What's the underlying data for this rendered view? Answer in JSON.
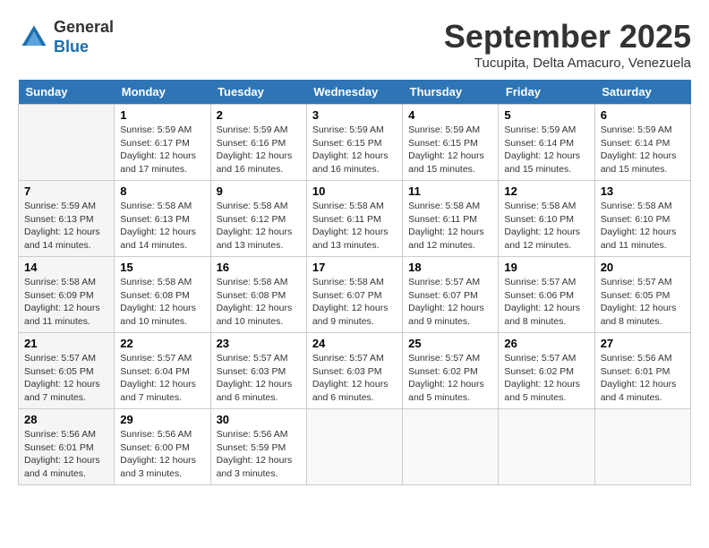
{
  "header": {
    "logo_line1": "General",
    "logo_line2": "Blue",
    "month": "September 2025",
    "location": "Tucupita, Delta Amacuro, Venezuela"
  },
  "weekdays": [
    "Sunday",
    "Monday",
    "Tuesday",
    "Wednesday",
    "Thursday",
    "Friday",
    "Saturday"
  ],
  "weeks": [
    [
      {
        "day": "",
        "info": ""
      },
      {
        "day": "1",
        "info": "Sunrise: 5:59 AM\nSunset: 6:17 PM\nDaylight: 12 hours\nand 17 minutes."
      },
      {
        "day": "2",
        "info": "Sunrise: 5:59 AM\nSunset: 6:16 PM\nDaylight: 12 hours\nand 16 minutes."
      },
      {
        "day": "3",
        "info": "Sunrise: 5:59 AM\nSunset: 6:15 PM\nDaylight: 12 hours\nand 16 minutes."
      },
      {
        "day": "4",
        "info": "Sunrise: 5:59 AM\nSunset: 6:15 PM\nDaylight: 12 hours\nand 15 minutes."
      },
      {
        "day": "5",
        "info": "Sunrise: 5:59 AM\nSunset: 6:14 PM\nDaylight: 12 hours\nand 15 minutes."
      },
      {
        "day": "6",
        "info": "Sunrise: 5:59 AM\nSunset: 6:14 PM\nDaylight: 12 hours\nand 15 minutes."
      }
    ],
    [
      {
        "day": "7",
        "info": "Sunrise: 5:59 AM\nSunset: 6:13 PM\nDaylight: 12 hours\nand 14 minutes."
      },
      {
        "day": "8",
        "info": "Sunrise: 5:58 AM\nSunset: 6:13 PM\nDaylight: 12 hours\nand 14 minutes."
      },
      {
        "day": "9",
        "info": "Sunrise: 5:58 AM\nSunset: 6:12 PM\nDaylight: 12 hours\nand 13 minutes."
      },
      {
        "day": "10",
        "info": "Sunrise: 5:58 AM\nSunset: 6:11 PM\nDaylight: 12 hours\nand 13 minutes."
      },
      {
        "day": "11",
        "info": "Sunrise: 5:58 AM\nSunset: 6:11 PM\nDaylight: 12 hours\nand 12 minutes."
      },
      {
        "day": "12",
        "info": "Sunrise: 5:58 AM\nSunset: 6:10 PM\nDaylight: 12 hours\nand 12 minutes."
      },
      {
        "day": "13",
        "info": "Sunrise: 5:58 AM\nSunset: 6:10 PM\nDaylight: 12 hours\nand 11 minutes."
      }
    ],
    [
      {
        "day": "14",
        "info": "Sunrise: 5:58 AM\nSunset: 6:09 PM\nDaylight: 12 hours\nand 11 minutes."
      },
      {
        "day": "15",
        "info": "Sunrise: 5:58 AM\nSunset: 6:08 PM\nDaylight: 12 hours\nand 10 minutes."
      },
      {
        "day": "16",
        "info": "Sunrise: 5:58 AM\nSunset: 6:08 PM\nDaylight: 12 hours\nand 10 minutes."
      },
      {
        "day": "17",
        "info": "Sunrise: 5:58 AM\nSunset: 6:07 PM\nDaylight: 12 hours\nand 9 minutes."
      },
      {
        "day": "18",
        "info": "Sunrise: 5:57 AM\nSunset: 6:07 PM\nDaylight: 12 hours\nand 9 minutes."
      },
      {
        "day": "19",
        "info": "Sunrise: 5:57 AM\nSunset: 6:06 PM\nDaylight: 12 hours\nand 8 minutes."
      },
      {
        "day": "20",
        "info": "Sunrise: 5:57 AM\nSunset: 6:05 PM\nDaylight: 12 hours\nand 8 minutes."
      }
    ],
    [
      {
        "day": "21",
        "info": "Sunrise: 5:57 AM\nSunset: 6:05 PM\nDaylight: 12 hours\nand 7 minutes."
      },
      {
        "day": "22",
        "info": "Sunrise: 5:57 AM\nSunset: 6:04 PM\nDaylight: 12 hours\nand 7 minutes."
      },
      {
        "day": "23",
        "info": "Sunrise: 5:57 AM\nSunset: 6:03 PM\nDaylight: 12 hours\nand 6 minutes."
      },
      {
        "day": "24",
        "info": "Sunrise: 5:57 AM\nSunset: 6:03 PM\nDaylight: 12 hours\nand 6 minutes."
      },
      {
        "day": "25",
        "info": "Sunrise: 5:57 AM\nSunset: 6:02 PM\nDaylight: 12 hours\nand 5 minutes."
      },
      {
        "day": "26",
        "info": "Sunrise: 5:57 AM\nSunset: 6:02 PM\nDaylight: 12 hours\nand 5 minutes."
      },
      {
        "day": "27",
        "info": "Sunrise: 5:56 AM\nSunset: 6:01 PM\nDaylight: 12 hours\nand 4 minutes."
      }
    ],
    [
      {
        "day": "28",
        "info": "Sunrise: 5:56 AM\nSunset: 6:01 PM\nDaylight: 12 hours\nand 4 minutes."
      },
      {
        "day": "29",
        "info": "Sunrise: 5:56 AM\nSunset: 6:00 PM\nDaylight: 12 hours\nand 3 minutes."
      },
      {
        "day": "30",
        "info": "Sunrise: 5:56 AM\nSunset: 5:59 PM\nDaylight: 12 hours\nand 3 minutes."
      },
      {
        "day": "",
        "info": ""
      },
      {
        "day": "",
        "info": ""
      },
      {
        "day": "",
        "info": ""
      },
      {
        "day": "",
        "info": ""
      }
    ]
  ]
}
